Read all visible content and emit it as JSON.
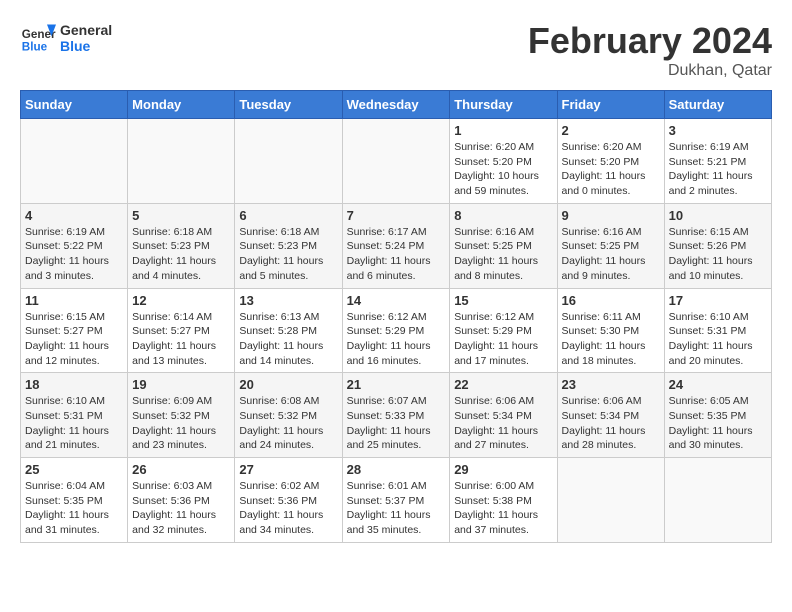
{
  "header": {
    "logo_line1": "General",
    "logo_line2": "Blue",
    "main_title": "February 2024",
    "subtitle": "Dukhan, Qatar"
  },
  "days_of_week": [
    "Sunday",
    "Monday",
    "Tuesday",
    "Wednesday",
    "Thursday",
    "Friday",
    "Saturday"
  ],
  "weeks": [
    [
      {
        "day": "",
        "info": ""
      },
      {
        "day": "",
        "info": ""
      },
      {
        "day": "",
        "info": ""
      },
      {
        "day": "",
        "info": ""
      },
      {
        "day": "1",
        "info": "Sunrise: 6:20 AM\nSunset: 5:20 PM\nDaylight: 10 hours\nand 59 minutes."
      },
      {
        "day": "2",
        "info": "Sunrise: 6:20 AM\nSunset: 5:20 PM\nDaylight: 11 hours\nand 0 minutes."
      },
      {
        "day": "3",
        "info": "Sunrise: 6:19 AM\nSunset: 5:21 PM\nDaylight: 11 hours\nand 2 minutes."
      }
    ],
    [
      {
        "day": "4",
        "info": "Sunrise: 6:19 AM\nSunset: 5:22 PM\nDaylight: 11 hours\nand 3 minutes."
      },
      {
        "day": "5",
        "info": "Sunrise: 6:18 AM\nSunset: 5:23 PM\nDaylight: 11 hours\nand 4 minutes."
      },
      {
        "day": "6",
        "info": "Sunrise: 6:18 AM\nSunset: 5:23 PM\nDaylight: 11 hours\nand 5 minutes."
      },
      {
        "day": "7",
        "info": "Sunrise: 6:17 AM\nSunset: 5:24 PM\nDaylight: 11 hours\nand 6 minutes."
      },
      {
        "day": "8",
        "info": "Sunrise: 6:16 AM\nSunset: 5:25 PM\nDaylight: 11 hours\nand 8 minutes."
      },
      {
        "day": "9",
        "info": "Sunrise: 6:16 AM\nSunset: 5:25 PM\nDaylight: 11 hours\nand 9 minutes."
      },
      {
        "day": "10",
        "info": "Sunrise: 6:15 AM\nSunset: 5:26 PM\nDaylight: 11 hours\nand 10 minutes."
      }
    ],
    [
      {
        "day": "11",
        "info": "Sunrise: 6:15 AM\nSunset: 5:27 PM\nDaylight: 11 hours\nand 12 minutes."
      },
      {
        "day": "12",
        "info": "Sunrise: 6:14 AM\nSunset: 5:27 PM\nDaylight: 11 hours\nand 13 minutes."
      },
      {
        "day": "13",
        "info": "Sunrise: 6:13 AM\nSunset: 5:28 PM\nDaylight: 11 hours\nand 14 minutes."
      },
      {
        "day": "14",
        "info": "Sunrise: 6:12 AM\nSunset: 5:29 PM\nDaylight: 11 hours\nand 16 minutes."
      },
      {
        "day": "15",
        "info": "Sunrise: 6:12 AM\nSunset: 5:29 PM\nDaylight: 11 hours\nand 17 minutes."
      },
      {
        "day": "16",
        "info": "Sunrise: 6:11 AM\nSunset: 5:30 PM\nDaylight: 11 hours\nand 18 minutes."
      },
      {
        "day": "17",
        "info": "Sunrise: 6:10 AM\nSunset: 5:31 PM\nDaylight: 11 hours\nand 20 minutes."
      }
    ],
    [
      {
        "day": "18",
        "info": "Sunrise: 6:10 AM\nSunset: 5:31 PM\nDaylight: 11 hours\nand 21 minutes."
      },
      {
        "day": "19",
        "info": "Sunrise: 6:09 AM\nSunset: 5:32 PM\nDaylight: 11 hours\nand 23 minutes."
      },
      {
        "day": "20",
        "info": "Sunrise: 6:08 AM\nSunset: 5:32 PM\nDaylight: 11 hours\nand 24 minutes."
      },
      {
        "day": "21",
        "info": "Sunrise: 6:07 AM\nSunset: 5:33 PM\nDaylight: 11 hours\nand 25 minutes."
      },
      {
        "day": "22",
        "info": "Sunrise: 6:06 AM\nSunset: 5:34 PM\nDaylight: 11 hours\nand 27 minutes."
      },
      {
        "day": "23",
        "info": "Sunrise: 6:06 AM\nSunset: 5:34 PM\nDaylight: 11 hours\nand 28 minutes."
      },
      {
        "day": "24",
        "info": "Sunrise: 6:05 AM\nSunset: 5:35 PM\nDaylight: 11 hours\nand 30 minutes."
      }
    ],
    [
      {
        "day": "25",
        "info": "Sunrise: 6:04 AM\nSunset: 5:35 PM\nDaylight: 11 hours\nand 31 minutes."
      },
      {
        "day": "26",
        "info": "Sunrise: 6:03 AM\nSunset: 5:36 PM\nDaylight: 11 hours\nand 32 minutes."
      },
      {
        "day": "27",
        "info": "Sunrise: 6:02 AM\nSunset: 5:36 PM\nDaylight: 11 hours\nand 34 minutes."
      },
      {
        "day": "28",
        "info": "Sunrise: 6:01 AM\nSunset: 5:37 PM\nDaylight: 11 hours\nand 35 minutes."
      },
      {
        "day": "29",
        "info": "Sunrise: 6:00 AM\nSunset: 5:38 PM\nDaylight: 11 hours\nand 37 minutes."
      },
      {
        "day": "",
        "info": ""
      },
      {
        "day": "",
        "info": ""
      }
    ]
  ]
}
